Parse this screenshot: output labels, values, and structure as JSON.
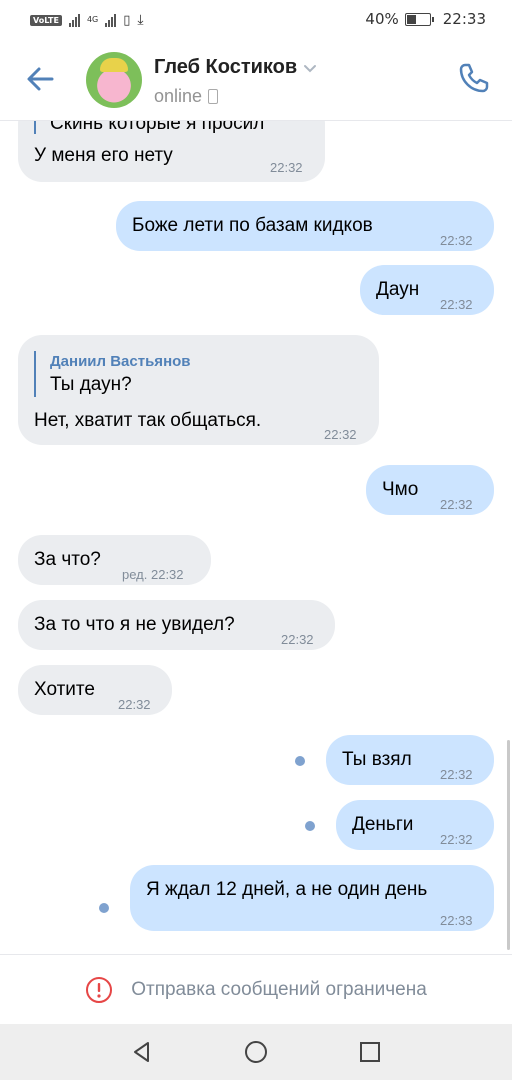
{
  "status_bar": {
    "volte": "VoLTE",
    "network": "4G",
    "battery": "40%",
    "battery_level": 0.4,
    "time": "22:33"
  },
  "header": {
    "name": "Глеб Костиков",
    "status": "online"
  },
  "messages": [
    {
      "direction": "in",
      "quote_text": "Скинь которые я просил",
      "text": "У меня его нету",
      "time": "22:32"
    },
    {
      "direction": "out",
      "text": "Боже лети по базам кидков",
      "time": "22:32"
    },
    {
      "direction": "out",
      "text": "Даун",
      "time": "22:32"
    },
    {
      "direction": "in",
      "reply_author": "Даниил Вастьянов",
      "reply_text": "Ты даун?",
      "text": "Нет, хватит так общаться.",
      "time": "22:32"
    },
    {
      "direction": "out",
      "text": "Чмо",
      "time": "22:32"
    },
    {
      "direction": "in",
      "text": "За что?",
      "time": "ред. 22:32"
    },
    {
      "direction": "in",
      "text": "За то что я не увидел?",
      "time": "22:32"
    },
    {
      "direction": "in",
      "text": "Хотите",
      "time": "22:32"
    },
    {
      "direction": "out",
      "text": "Ты взял",
      "time": "22:32",
      "unread": true
    },
    {
      "direction": "out",
      "text": "Деньги",
      "time": "22:32",
      "unread": true
    },
    {
      "direction": "out",
      "text": "Я ждал 12 дней, а не один день",
      "time": "22:33",
      "unread": true
    }
  ],
  "restriction": {
    "text": "Отправка сообщений ограничена"
  },
  "colors": {
    "accent": "#5181b8",
    "incoming_bubble": "#ebedf0",
    "outgoing_bubble": "#cce4ff",
    "warning": "#e64646"
  },
  "icons": {
    "back": "back-arrow-icon",
    "call": "phone-icon",
    "warning": "warning-circle-icon",
    "nav_back": "triangle-back-icon",
    "nav_home": "circle-home-icon",
    "nav_recent": "square-recent-icon"
  }
}
